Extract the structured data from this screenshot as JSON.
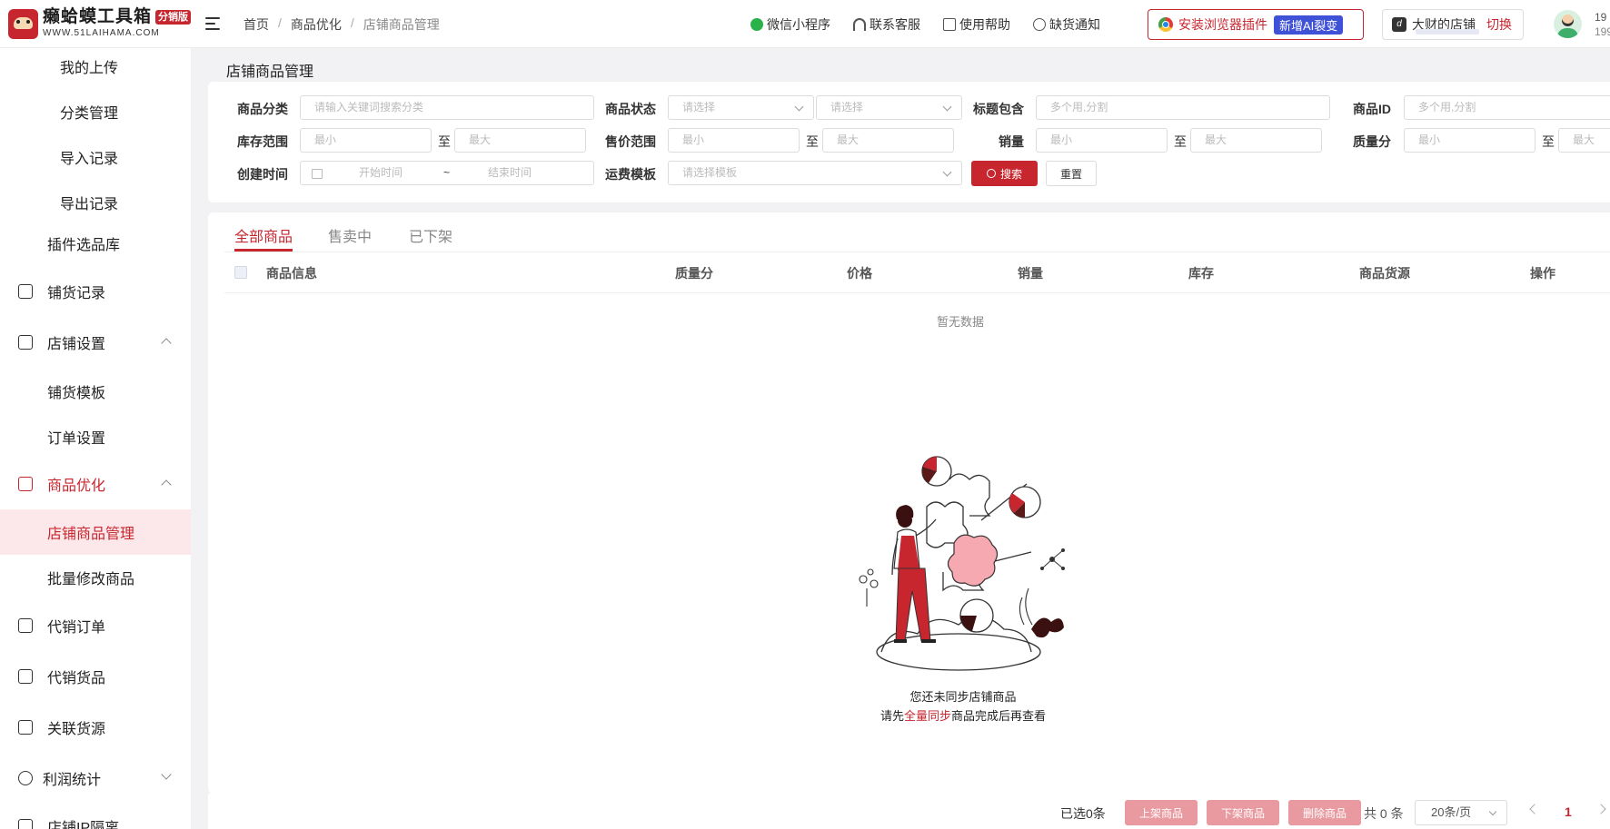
{
  "header": {
    "brand_name": "癞蛤蟆工具箱",
    "brand_badge": "分销版",
    "brand_url": "WWW.51LAIHAMA.COM",
    "breadcrumb": [
      "首页",
      "商品优化",
      "店铺商品管理"
    ],
    "links": [
      {
        "label": "微信小程序",
        "icon": "wechat-icon"
      },
      {
        "label": "联系客服",
        "icon": "headset-icon"
      },
      {
        "label": "使用帮助",
        "icon": "doc-icon"
      },
      {
        "label": "缺货通知",
        "icon": "bell-icon"
      }
    ],
    "plugin_label": "安装浏览器插件",
    "plugin_tag": "新增AI裂变",
    "shop_name": "大财的店铺",
    "shop_switch": "切换",
    "user_number_1": "19",
    "user_number_2": "199"
  },
  "sidebar": {
    "items": [
      {
        "label": "我的上传"
      },
      {
        "label": "分类管理"
      },
      {
        "label": "导入记录"
      },
      {
        "label": "导出记录"
      },
      {
        "label": "插件选品库"
      },
      {
        "label": "铺货记录"
      },
      {
        "label": "店铺设置"
      },
      {
        "label": "铺货模板"
      },
      {
        "label": "订单设置"
      },
      {
        "label": "商品优化"
      },
      {
        "label": "店铺商品管理"
      },
      {
        "label": "批量修改商品"
      },
      {
        "label": "代销订单"
      },
      {
        "label": "代销货品"
      },
      {
        "label": "关联货源"
      },
      {
        "label": "利润统计"
      },
      {
        "label": "店铺IP隔离"
      }
    ]
  },
  "page": {
    "title": "店铺商品管理"
  },
  "filters": {
    "category_label": "商品分类",
    "category_placeholder": "请输入关键词搜索分类",
    "status_label": "商品状态",
    "status_placeholder_1": "请选择",
    "status_placeholder_2": "请选择",
    "title_label": "标题包含",
    "title_placeholder": "多个用,分割",
    "id_label": "商品ID",
    "id_placeholder": "多个用,分割",
    "stock_label": "库存范围",
    "price_label": "售价范围",
    "sales_label": "销量",
    "quality_label": "质量分",
    "min_placeholder": "最小",
    "max_placeholder": "最大",
    "to": "至",
    "created_label": "创建时间",
    "start_placeholder": "开始时间",
    "end_placeholder": "结束时间",
    "range_sep": "~",
    "shipping_label": "运费模板",
    "shipping_placeholder": "请选择模板",
    "search_button": "搜索",
    "reset_button": "重置"
  },
  "tabs": [
    {
      "label": "全部商品",
      "active": true
    },
    {
      "label": "售卖中",
      "active": false
    },
    {
      "label": "已下架",
      "active": false
    }
  ],
  "table": {
    "columns": [
      "商品信息",
      "质量分",
      "价格",
      "销量",
      "库存",
      "商品货源",
      "操作"
    ],
    "empty_text": "暂无数据"
  },
  "empty_state": {
    "line1": "您还未同步店铺商品",
    "line2_prefix": "请先",
    "line2_link": "全量同步",
    "line2_suffix": "商品完成后再查看"
  },
  "footer": {
    "selected": "已选0条",
    "btn_on_shelf": "上架商品",
    "btn_off_shelf": "下架商品",
    "btn_delete": "删除商品",
    "total": "共 0 条",
    "page_size": "20条/页",
    "current_page": "1"
  },
  "colors": {
    "accent": "#c8262f",
    "accent_light": "#fce8ea",
    "disabled_button": "#e99aa0"
  }
}
